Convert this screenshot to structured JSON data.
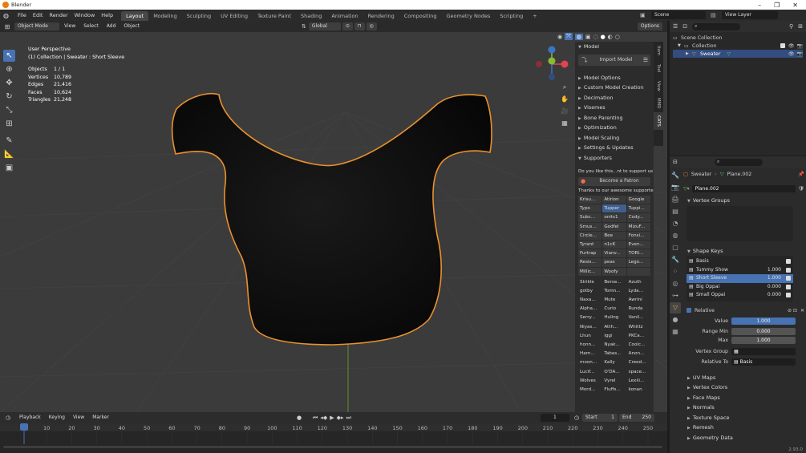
{
  "app": {
    "title": "Blender"
  },
  "menubar": {
    "menus": [
      "File",
      "Edit",
      "Render",
      "Window",
      "Help"
    ],
    "workspaces": [
      "Layout",
      "Modeling",
      "Sculpting",
      "UV Editing",
      "Texture Paint",
      "Shading",
      "Animation",
      "Rendering",
      "Compositing",
      "Geometry Nodes",
      "Scripting"
    ],
    "active_workspace": "Layout",
    "scene": "Scene",
    "view_layer": "View Layer"
  },
  "viewport": {
    "mode": "Object Mode",
    "menus": [
      "View",
      "Select",
      "Add",
      "Object"
    ],
    "transform": "Global",
    "options": "Options",
    "perspective": "User Perspective",
    "collection_path": "(1) Collection | Sweater : Short Sleeve",
    "stats": [
      {
        "label": "Objects",
        "value": "1 / 1"
      },
      {
        "label": "Vertices",
        "value": "10,789"
      },
      {
        "label": "Edges",
        "value": "21,416"
      },
      {
        "label": "Faces",
        "value": "10,624"
      },
      {
        "label": "Triangles",
        "value": "21,248"
      }
    ]
  },
  "npanel": {
    "model_header": "Model",
    "import_button": "Import Model",
    "sections": [
      "Model Options",
      "Custom Model Creation",
      "Decimation",
      "Visemes",
      "Bone Parenting",
      "Optimization",
      "Model Scaling",
      "Settings & Updates",
      "Supporters"
    ],
    "support_text": "Do you like this...nt to support us?",
    "patron_button": "Become a Patron",
    "thanks_text": "Thanks to our awesome supporte...",
    "patrons_top": [
      "Krisu...",
      "Atirion",
      "Googie",
      "Typo",
      "Tupper",
      "Tuppi...",
      "Subc...",
      "onits1",
      "Cody...",
      "Smus...",
      "Godfel",
      "MizuF...",
      "Circle...",
      "Bee",
      "Fonsi...",
      "Tyrant",
      "n1cK",
      "Even...",
      "Furtrap",
      "Vianv...",
      "TORI...",
      "Resis...",
      "peas",
      "Lego...",
      "Millic...",
      "Woofy",
      ""
    ],
    "patrons_bottom": [
      "Strikle",
      "Berse...",
      "Azuth",
      "gotby",
      "Tomn...",
      "Lyda...",
      "Naxa...",
      "Mute",
      "Awrini",
      "Alpha...",
      "Curio",
      "Runda",
      "Serry...",
      "Huling",
      "Vanil...",
      "Niyas...",
      "Atth...",
      "Whittz",
      "Lhun",
      "iggi",
      "PKCa...",
      "honn...",
      "Nyak...",
      "Coolc...",
      "Harn...",
      "Tabas...",
      "Anon...",
      "moon...",
      "Kally",
      "Creed...",
      "Lucif...",
      "O'DA...",
      "space...",
      "Wolves",
      "Vyrel",
      "Lexiii...",
      "Mord...",
      "Fluffs...",
      "konan"
    ],
    "tabs": [
      "Item",
      "Tool",
      "View",
      "MMD",
      "CATS"
    ]
  },
  "timeline": {
    "menus": [
      "Playback",
      "Keying",
      "View",
      "Marker"
    ],
    "current_frame": "1",
    "start_label": "Start",
    "start": "1",
    "end_label": "End",
    "end": "250",
    "ticks": [
      "1",
      "10",
      "20",
      "30",
      "40",
      "50",
      "60",
      "70",
      "80",
      "90",
      "100",
      "110",
      "120",
      "130",
      "140",
      "150",
      "160",
      "170",
      "180",
      "190",
      "200",
      "210",
      "220",
      "230",
      "240",
      "250"
    ],
    "version": "2.93.0"
  },
  "outliner": {
    "scene_collection": "Scene Collection",
    "collection": "Collection",
    "object": "Sweater"
  },
  "properties": {
    "object_name": "Sweater",
    "mesh_name": "Plane.002",
    "data_name": "Plane.002",
    "vertex_groups": "Vertex Groups",
    "shape_keys_header": "Shape Keys",
    "shape_keys": [
      {
        "name": "Basis",
        "value": ""
      },
      {
        "name": "Tummy Show",
        "value": "1.000"
      },
      {
        "name": "Short Sleeve",
        "value": "1.000"
      },
      {
        "name": "Big Oppai",
        "value": "0.000"
      },
      {
        "name": "Small Oppai",
        "value": "0.000"
      }
    ],
    "relative_label": "Relative",
    "value_label": "Value",
    "value": "1.000",
    "range_min_label": "Range Min",
    "range_min": "0.000",
    "max_label": "Max",
    "max": "1.000",
    "vertex_group_label": "Vertex Group",
    "relative_to_label": "Relative To",
    "relative_to": "Basis",
    "sections": [
      "UV Maps",
      "Vertex Colors",
      "Face Maps",
      "Normals",
      "Texture Space",
      "Remesh",
      "Geometry Data"
    ]
  },
  "colors": {
    "accent": "#4772b3",
    "selection": "#e8912d",
    "patreon": "#f96854"
  }
}
